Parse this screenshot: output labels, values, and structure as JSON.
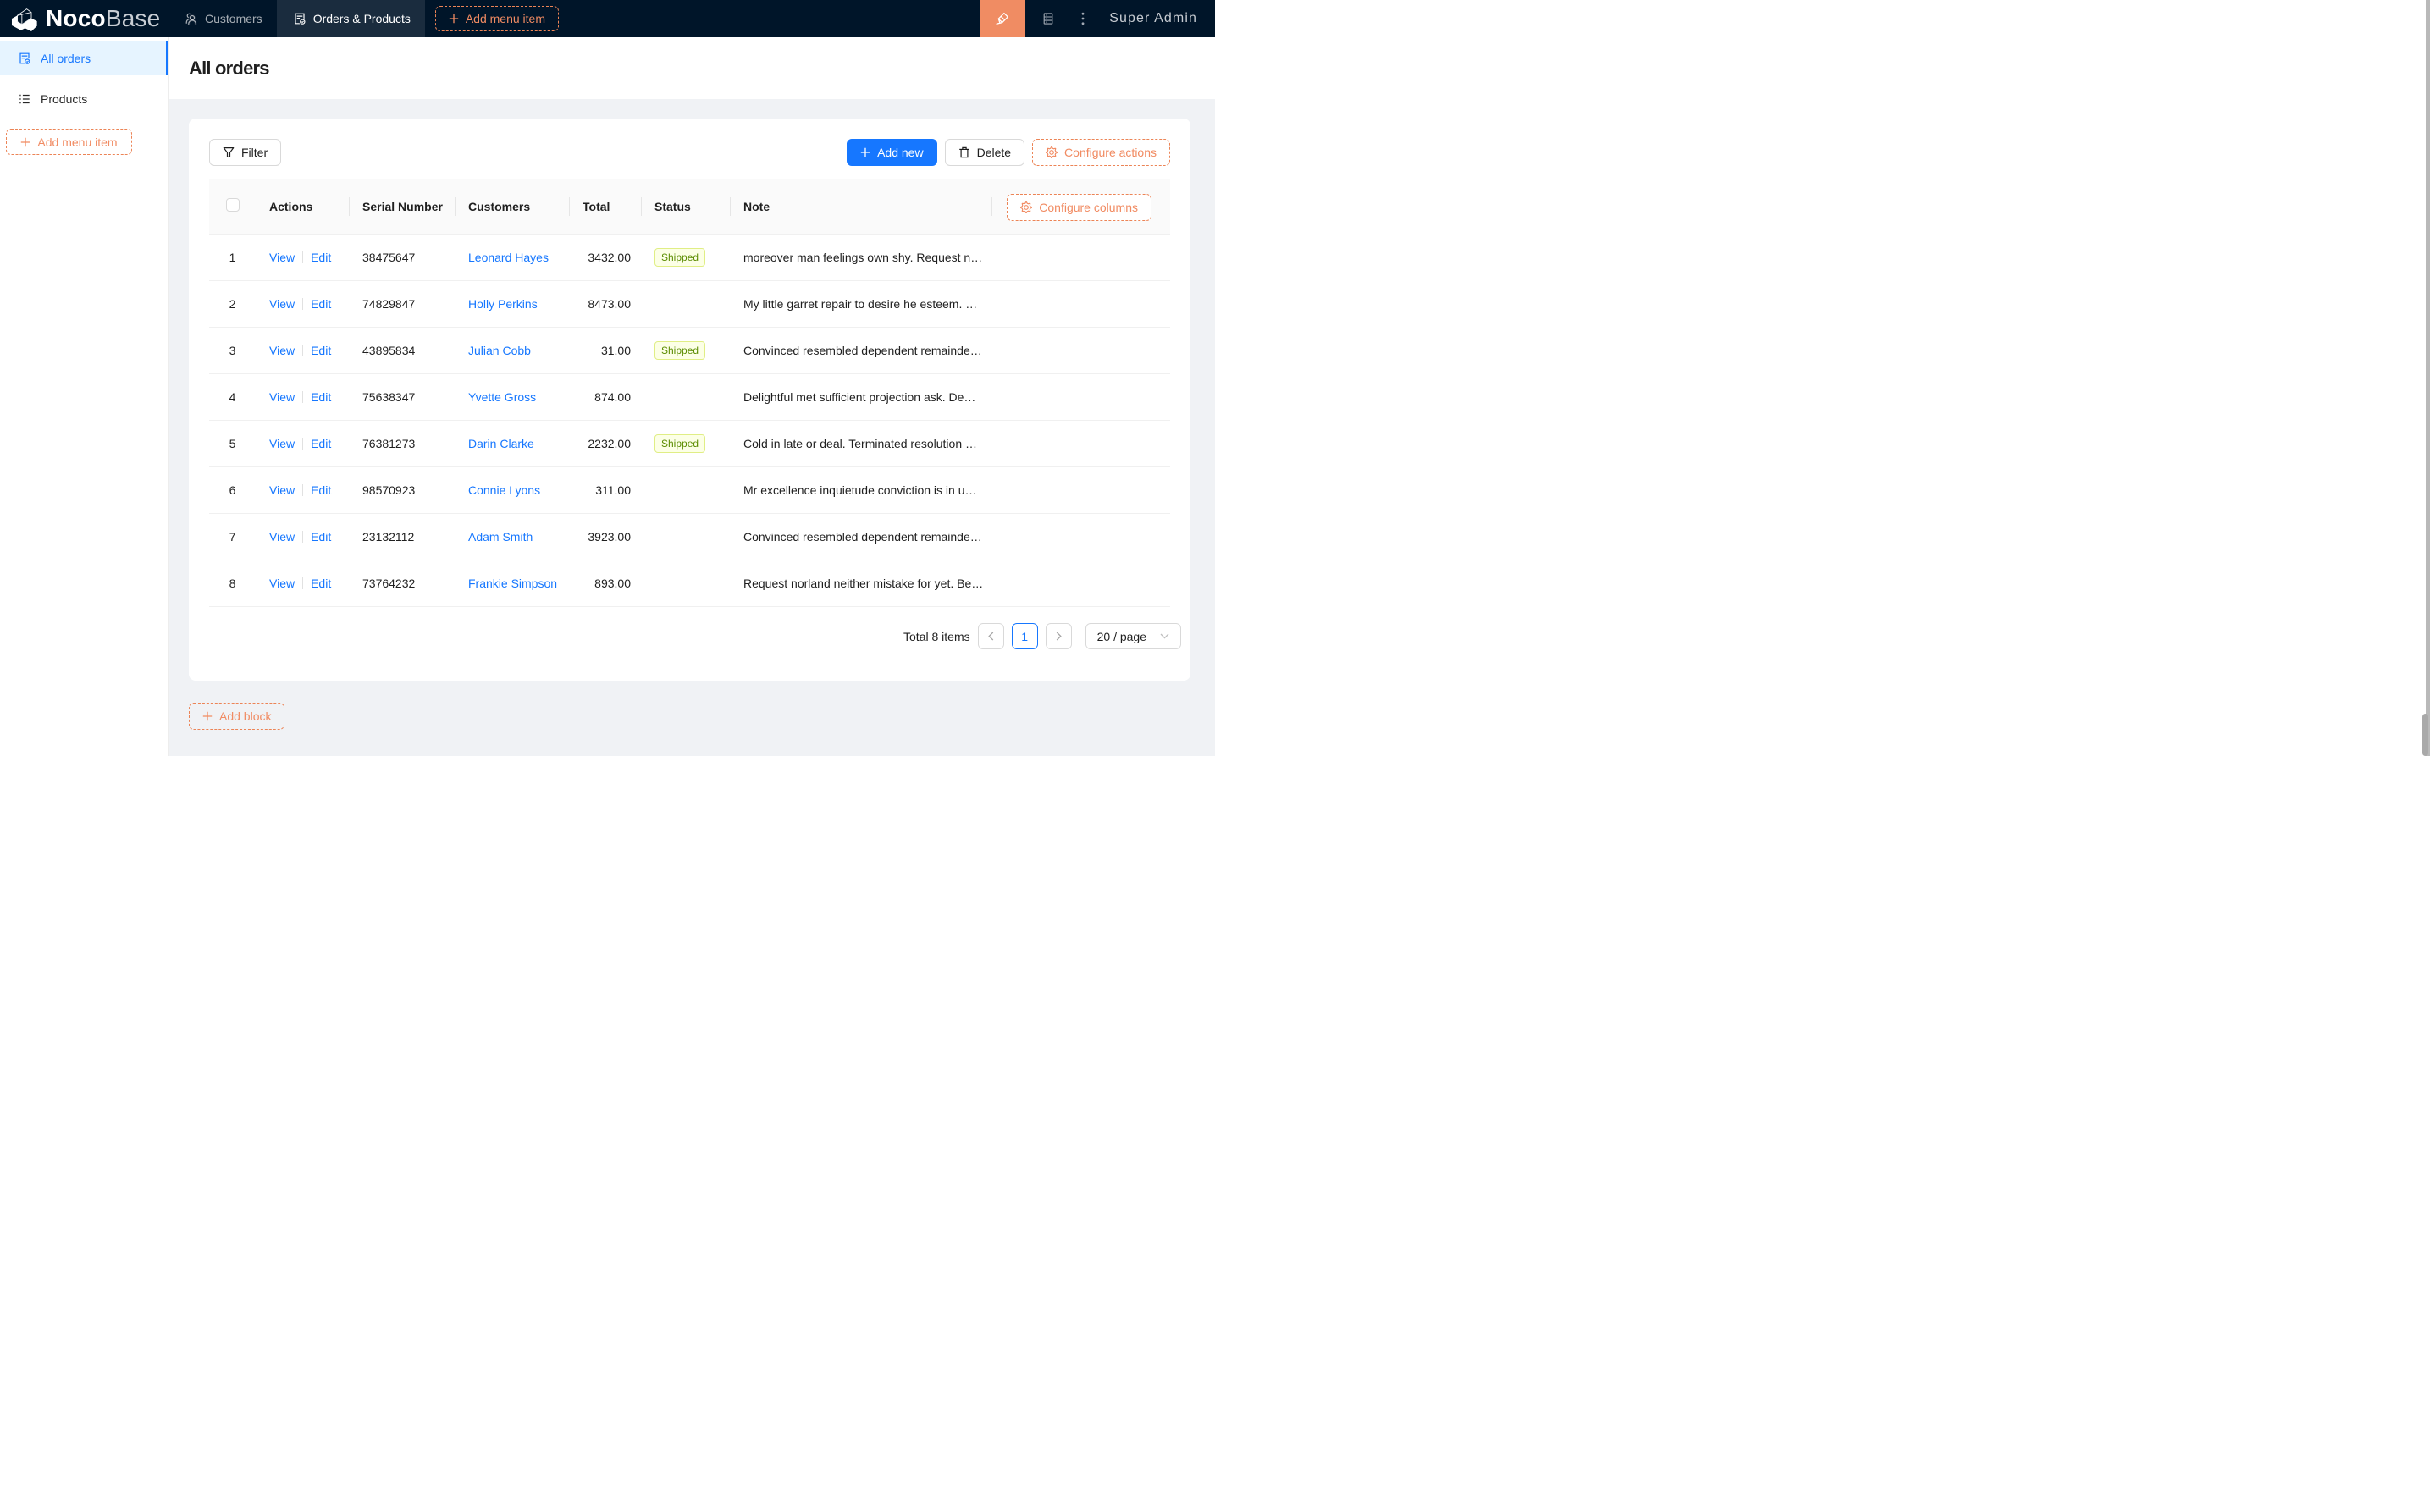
{
  "header": {
    "logo": {
      "bold": "Noco",
      "light": "Base"
    },
    "menu": [
      {
        "label": "Customers"
      },
      {
        "label": "Orders & Products"
      }
    ],
    "add_menu_item": "Add menu item",
    "user": "Super Admin"
  },
  "sidebar": {
    "items": [
      {
        "label": "All orders"
      },
      {
        "label": "Products"
      }
    ],
    "add_menu_item": "Add menu item"
  },
  "page": {
    "title": "All orders"
  },
  "toolbar": {
    "filter": "Filter",
    "add_new": "Add new",
    "delete": "Delete",
    "configure_actions": "Configure actions",
    "configure_columns": "Configure columns"
  },
  "table": {
    "columns": [
      "Actions",
      "Serial Number",
      "Customers",
      "Total",
      "Status",
      "Note"
    ],
    "action_labels": {
      "view": "View",
      "edit": "Edit"
    },
    "status_shipped": "Shipped",
    "rows": [
      {
        "index": "1",
        "serial": "38475647",
        "customer": "Leonard Hayes",
        "total": "3432.00",
        "status": "Shipped",
        "note": "moreover man feelings own shy. Request n…"
      },
      {
        "index": "2",
        "serial": "74829847",
        "customer": "Holly Perkins",
        "total": "8473.00",
        "status": "",
        "note": "My little garret repair to desire he esteem. …"
      },
      {
        "index": "3",
        "serial": "43895834",
        "customer": "Julian Cobb",
        "total": "31.00",
        "status": "Shipped",
        "note": "Convinced resembled dependent remainde…"
      },
      {
        "index": "4",
        "serial": "75638347",
        "customer": "Yvette Gross",
        "total": "874.00",
        "status": "",
        "note": "Delightful met sufficient projection ask. De…"
      },
      {
        "index": "5",
        "serial": "76381273",
        "customer": "Darin Clarke",
        "total": "2232.00",
        "status": "Shipped",
        "note": "Cold in late or deal. Terminated resolution …"
      },
      {
        "index": "6",
        "serial": "98570923",
        "customer": "Connie Lyons",
        "total": "311.00",
        "status": "",
        "note": "Mr excellence inquietude conviction is in u…"
      },
      {
        "index": "7",
        "serial": "23132112",
        "customer": "Adam Smith",
        "total": "3923.00",
        "status": "",
        "note": "Convinced resembled dependent remainde…"
      },
      {
        "index": "8",
        "serial": "73764232",
        "customer": "Frankie Simpson",
        "total": "893.00",
        "status": "",
        "note": "Request norland neither mistake for yet. Be…"
      }
    ]
  },
  "pagination": {
    "total": "Total 8 items",
    "page": "1",
    "page_size": "20 / page"
  },
  "footer": {
    "add_block": "Add block"
  },
  "colors": {
    "header_bg": "#001529",
    "primary": "#1677ff",
    "designer_orange": "#F18B62",
    "selected_menu_bg": "#e6f4ff",
    "tag_lime_bg": "#fcffe6",
    "tag_lime_text": "#5b8c00",
    "page_bg": "#f0f2f5"
  }
}
